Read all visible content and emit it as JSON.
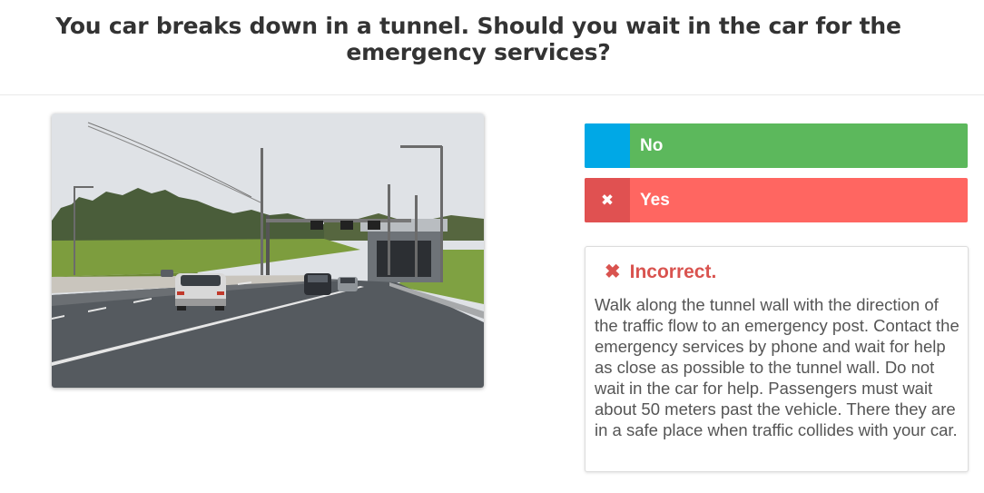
{
  "question": {
    "text": "You car breaks down in a tunnel. Should you wait in the car for the emergency services?"
  },
  "image": {
    "subject": "highway approaching a tunnel entrance with cars"
  },
  "answers": [
    {
      "label": "No",
      "marker_icon": "",
      "state": "correct"
    },
    {
      "label": "Yes",
      "marker_icon": "✖",
      "state": "selected-incorrect"
    }
  ],
  "feedback": {
    "icon": "✖",
    "title": "Incorrect.",
    "text": "Walk along the tunnel wall with the direction of the traffic flow to an emergency post. Contact the emergency services by phone and wait for help as close as possible to the tunnel wall. Do not wait in the car for help. Passengers must wait about 50 meters past the vehicle. There they are in a safe place when traffic collides with your car."
  },
  "colors": {
    "correct_bg": "#5cb85c",
    "correct_marker": "#00a8e6",
    "incorrect_bg": "#ff6661",
    "incorrect_marker": "#e05151",
    "feedback_title": "#d9534f"
  }
}
